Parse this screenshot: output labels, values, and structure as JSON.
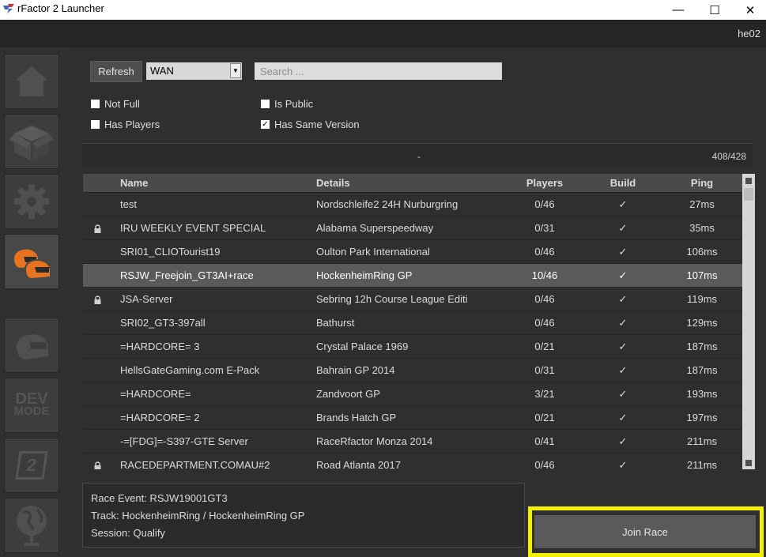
{
  "window": {
    "title": "rFactor 2 Launcher",
    "minimize_glyph": "—",
    "maximize_glyph": "☐",
    "close_glyph": "✕"
  },
  "topbar": {
    "user": "he02"
  },
  "sidebar": {
    "items": [
      {
        "name": "home",
        "icon": "home-icon"
      },
      {
        "name": "content",
        "icon": "box-icon"
      },
      {
        "name": "settings",
        "icon": "gear-icon"
      },
      {
        "name": "multiplayer",
        "icon": "helmets-icon",
        "active": true
      },
      {
        "name": "single-player",
        "icon": "helmet-icon"
      },
      {
        "name": "dev-mode",
        "icon": "dev-mode-icon",
        "line1": "DEV",
        "line2": "MODE"
      },
      {
        "name": "rfactor2",
        "icon": "rf2-logo-icon",
        "label": "2"
      },
      {
        "name": "community",
        "icon": "globe-icon"
      }
    ]
  },
  "filters": {
    "refresh_label": "Refresh",
    "network_value": "WAN",
    "search_placeholder": "Search ...",
    "not_full": {
      "label": "Not Full",
      "checked": false
    },
    "is_public": {
      "label": "Is Public",
      "checked": false
    },
    "has_players": {
      "label": "Has Players",
      "checked": false
    },
    "same_version": {
      "label": "Has Same Version",
      "checked": true
    },
    "check_glyph": "✓"
  },
  "status": {
    "text": "-",
    "count": "408/428"
  },
  "table": {
    "headers": {
      "name": "Name",
      "details": "Details",
      "players": "Players",
      "build": "Build",
      "ping": "Ping"
    },
    "rows": [
      {
        "locked": false,
        "name": "test",
        "details": "Nordschleife2 24H Nurburgring",
        "players": "0/46",
        "build": "✓",
        "ping": "27ms"
      },
      {
        "locked": true,
        "name": "IRU WEEKLY EVENT SPECIAL",
        "details": "Alabama Superspeedway",
        "players": "0/31",
        "build": "✓",
        "ping": "35ms"
      },
      {
        "locked": false,
        "name": "SRI01_CLIOTourist19",
        "details": "Oulton Park International",
        "players": "0/46",
        "build": "✓",
        "ping": "106ms"
      },
      {
        "locked": false,
        "name": "RSJW_Freejoin_GT3AI+race",
        "details": "HockenheimRing GP",
        "players": "10/46",
        "build": "✓",
        "ping": "107ms",
        "selected": true
      },
      {
        "locked": true,
        "name": "JSA-Server",
        "details": "Sebring 12h Course League Editi",
        "players": "0/46",
        "build": "✓",
        "ping": "119ms"
      },
      {
        "locked": false,
        "name": "SRI02_GT3-397all",
        "details": "Bathurst",
        "players": "0/46",
        "build": "✓",
        "ping": "129ms"
      },
      {
        "locked": false,
        "name": "=HARDCORE= 3",
        "details": "Crystal Palace 1969",
        "players": "0/21",
        "build": "✓",
        "ping": "187ms"
      },
      {
        "locked": false,
        "name": "HellsGateGaming.com E-Pack",
        "details": "Bahrain GP 2014",
        "players": "0/31",
        "build": "✓",
        "ping": "187ms"
      },
      {
        "locked": false,
        "name": "=HARDCORE=",
        "details": "Zandvoort GP",
        "players": "3/21",
        "build": "✓",
        "ping": "193ms"
      },
      {
        "locked": false,
        "name": "=HARDCORE= 2",
        "details": "Brands Hatch GP",
        "players": "0/21",
        "build": "✓",
        "ping": "197ms"
      },
      {
        "locked": false,
        "name": "-=[FDG]=-S397-GTE Server",
        "details": "RaceRfactor Monza 2014",
        "players": "0/41",
        "build": "✓",
        "ping": "211ms"
      },
      {
        "locked": true,
        "name": "RACEDEPARTMENT.COMAU#2",
        "details": "Road Atlanta 2017",
        "players": "0/46",
        "build": "✓",
        "ping": "211ms"
      }
    ]
  },
  "details_panel": {
    "race_event": "Race Event: RSJW19001GT3",
    "track": "Track: HockenheimRing / HockenheimRing GP",
    "session": "Session: Qualify"
  },
  "join_label": "Join Race",
  "colors": {
    "accent_orange": "#e8731f",
    "highlight_yellow": "#f2f000"
  }
}
